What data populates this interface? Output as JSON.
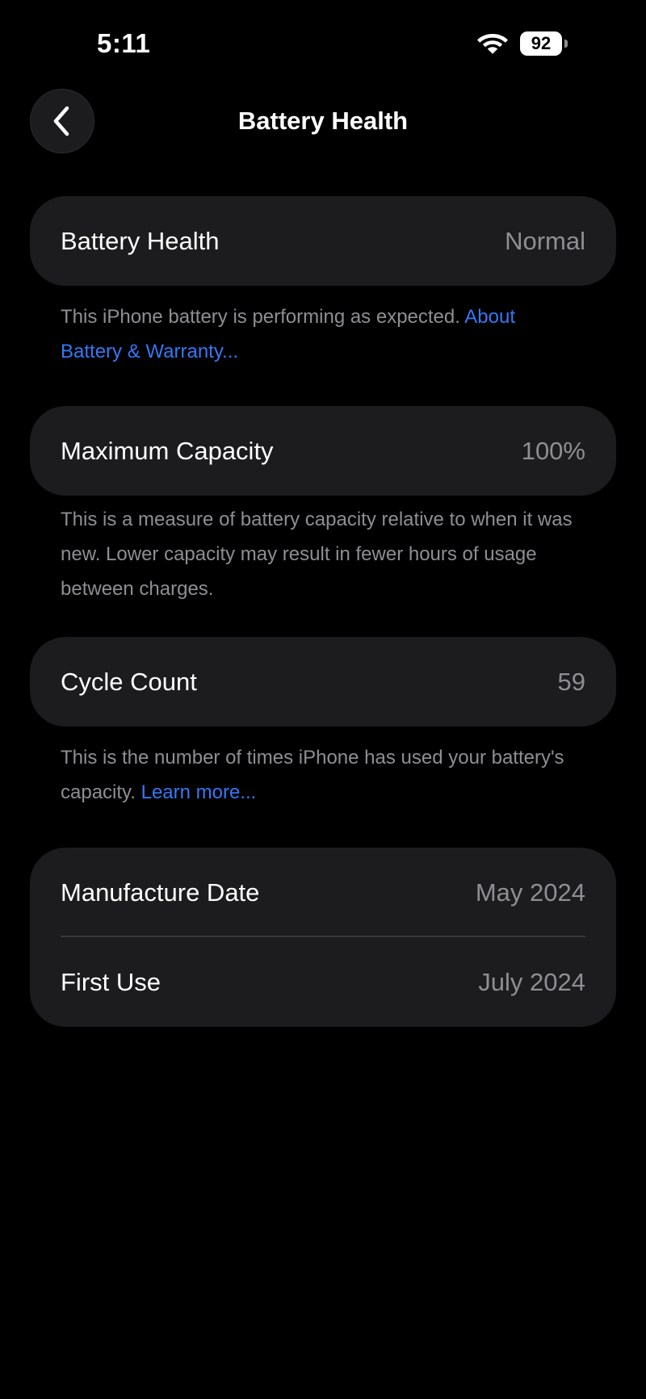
{
  "status_bar": {
    "time": "5:11",
    "battery_level": "92"
  },
  "nav": {
    "title": "Battery Health"
  },
  "health_card": {
    "label": "Battery Health",
    "value": "Normal",
    "footnote_text": "This iPhone battery is performing as expected.",
    "footnote_link": "About Battery & Warranty..."
  },
  "capacity_card": {
    "label": "Maximum Capacity",
    "value": "100%",
    "footnote_text": "This is a measure of battery capacity relative to when it was new. Lower capacity may result in fewer hours of usage between charges."
  },
  "cycle_card": {
    "label": "Cycle Count",
    "value": "59",
    "footnote_text": "This is the number of times iPhone has used your battery's capacity.",
    "footnote_link": "Learn more..."
  },
  "dates_card": {
    "manufacture_label": "Manufacture Date",
    "manufacture_value": "May 2024",
    "first_use_label": "First Use",
    "first_use_value": "July 2024"
  },
  "colors": {
    "background": "#000000",
    "card": "#1c1c1e",
    "secondary_text": "#8e8e93",
    "link": "#3478f6"
  }
}
